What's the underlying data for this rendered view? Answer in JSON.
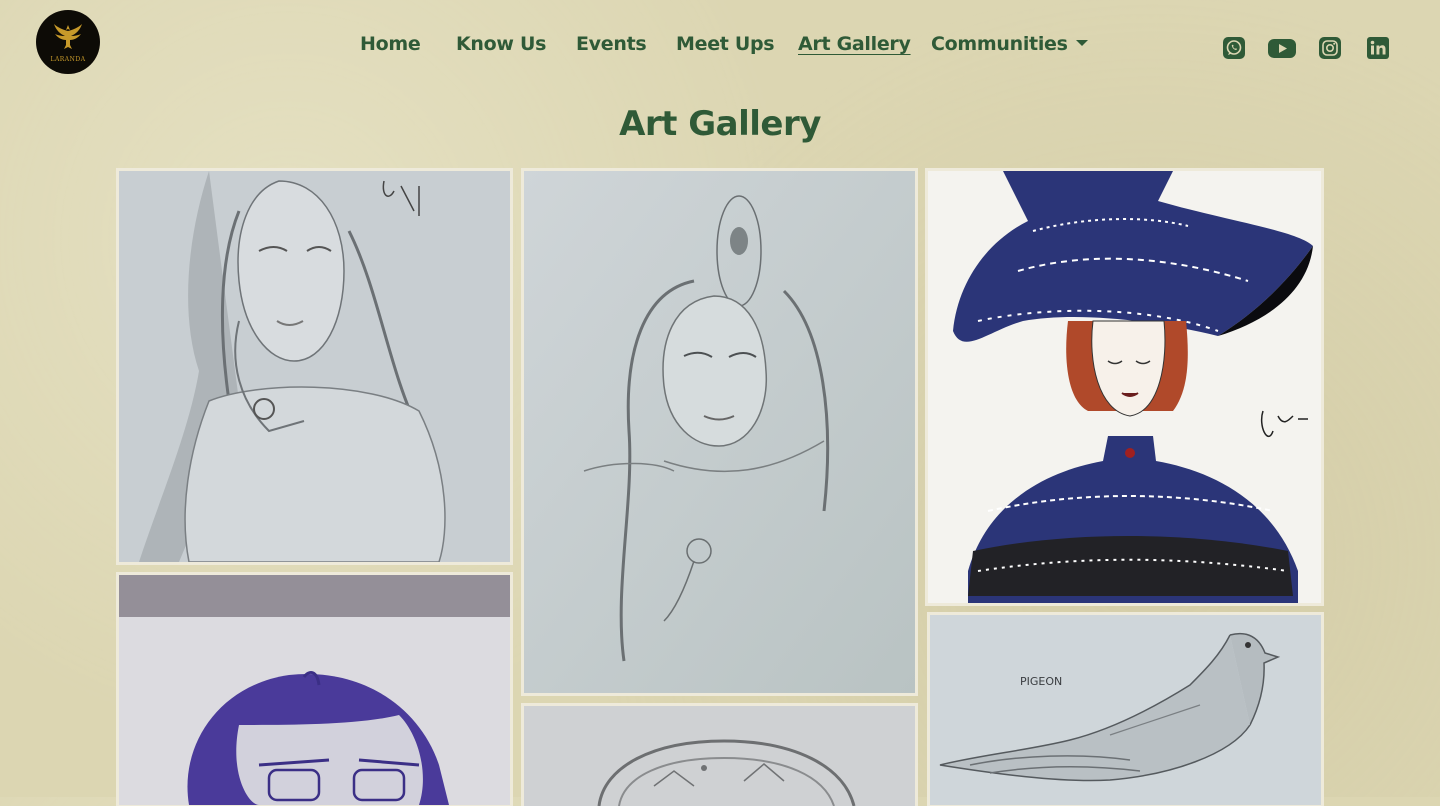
{
  "brand": {
    "logo_text": "LARANDA",
    "logo_icon": "phoenix-icon"
  },
  "nav": {
    "items": [
      {
        "label": "Home"
      },
      {
        "label": "Know Us"
      },
      {
        "label": "Events"
      },
      {
        "label": "Meet Ups"
      },
      {
        "label": "Art Gallery",
        "active": true
      },
      {
        "label": "Communities",
        "has_dropdown": true
      }
    ]
  },
  "social": [
    {
      "icon": "whatsapp-icon"
    },
    {
      "icon": "youtube-icon"
    },
    {
      "icon": "instagram-icon"
    },
    {
      "icon": "linkedin-icon"
    }
  ],
  "page": {
    "title": "Art Gallery"
  },
  "gallery": {
    "artworks": [
      {
        "subject": "pencil sketch of a woman resting chin on hand",
        "signature": "SANTU ART"
      },
      {
        "subject": "pencil sketch of a woman with peacock feather"
      },
      {
        "subject": "mandala art woman in patterned hat",
        "signature": "Ishita..."
      },
      {
        "subject": "blue ink sketch of a person with glasses"
      },
      {
        "subject": "pencil sketch of a circular landscape"
      },
      {
        "subject": "pencil sketch of a pigeon",
        "caption": "PIGEON"
      }
    ]
  },
  "colors": {
    "brand_green": "#2f5a37",
    "background": "#dcd6b2",
    "logo_gold": "#c79a2a"
  }
}
